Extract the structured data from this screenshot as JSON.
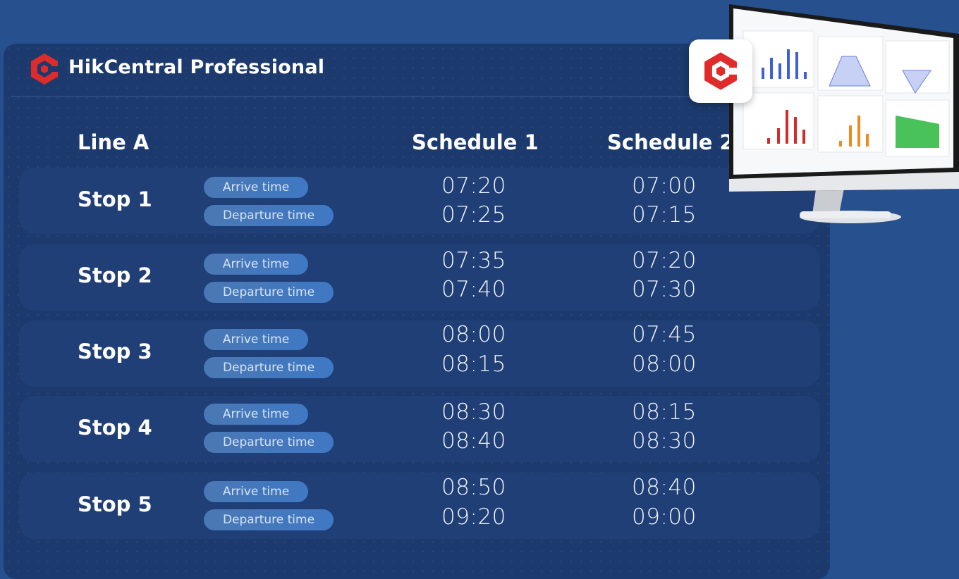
{
  "brand": {
    "name": "HikCentral Professional",
    "logo_icon": "hik-logo-icon",
    "accent": "#e02b2b"
  },
  "columns": {
    "line": "Line A",
    "schedule1": "Schedule 1",
    "schedule2": "Schedule 2"
  },
  "labels": {
    "arrive": "Arrive time",
    "depart": "Departure time"
  },
  "stops": [
    {
      "name": "Stop 1",
      "s1_arrive": "07:20",
      "s1_depart": "07:25",
      "s2_arrive": "07:00",
      "s2_depart": "07:15"
    },
    {
      "name": "Stop 2",
      "s1_arrive": "07:35",
      "s1_depart": "07:40",
      "s2_arrive": "07:20",
      "s2_depart": "07:30"
    },
    {
      "name": "Stop 3",
      "s1_arrive": "08:00",
      "s1_depart": "08:15",
      "s2_arrive": "07:45",
      "s2_depart": "08:00"
    },
    {
      "name": "Stop 4",
      "s1_arrive": "08:30",
      "s1_depart": "08:40",
      "s2_arrive": "08:15",
      "s2_depart": "08:30"
    },
    {
      "name": "Stop 5",
      "s1_arrive": "08:50",
      "s1_depart": "09:20",
      "s2_arrive": "08:40",
      "s2_depart": "09:00"
    }
  ],
  "decor": {
    "monitor_icon": "dashboard-monitor-illustration",
    "app_icon": "hikcentral-app-icon"
  }
}
